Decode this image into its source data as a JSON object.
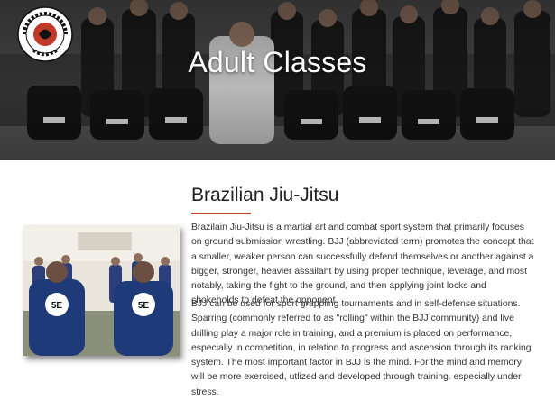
{
  "header": {
    "title": "Adult Classes",
    "logo_text": "LUTON GRAPPLING CLUB",
    "logo_icon": "grappling-club-logo"
  },
  "section": {
    "title": "Brazilian Jiu-Jitsu",
    "accent_color": "#c0392b",
    "image_text": "5E",
    "paragraphs": [
      "Brazilain Jiu-Jitsu is a martial art and combat sport system that primarily focuses on ground submission wrestling. BJJ (abbreviated term) promotes the concept that a smaller, weaker person can successfully defend themselves or another against a bigger, stronger, heavier assailant by using proper technique, leverage, and most notably, taking the fight to the ground, and then applying joint locks and chokeholds to defeat the opponent.",
      "BJJ can be used for sport grappling tournaments and in self-defense situations. Sparring (commonly referred to as \"rolling\" within the BJJ community) and live drilling play a major role in training, and a premium is placed on performance, especially in competition, in relation to progress and ascension through its ranking system. The most important factor in BJJ is the mind. For the mind and memory will be more exercised, utlized and developed through training. especially under stress."
    ]
  }
}
